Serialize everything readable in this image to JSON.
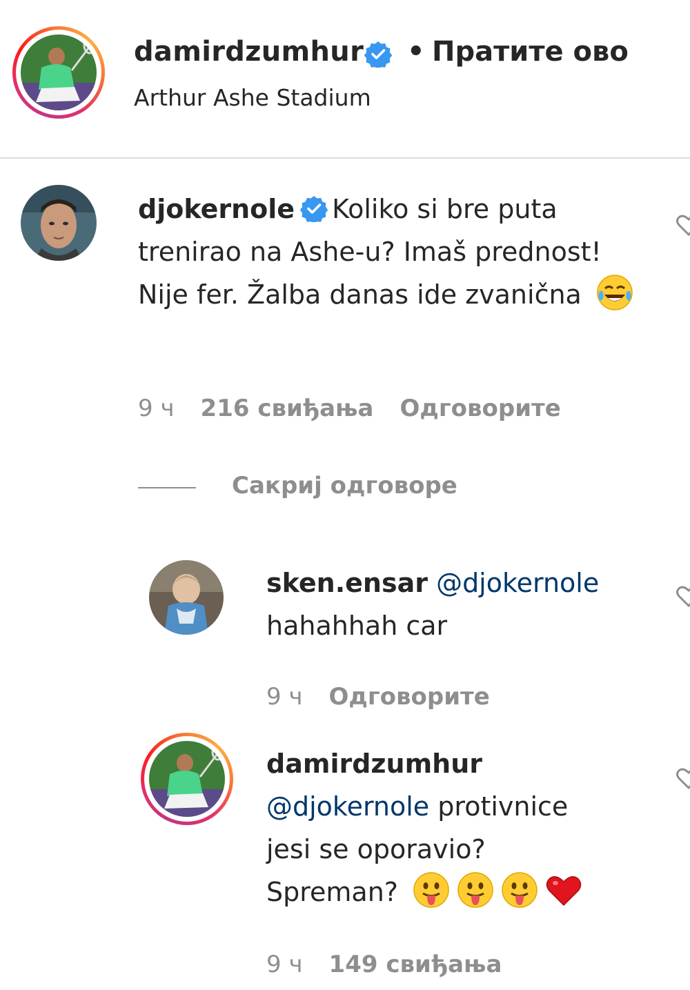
{
  "header": {
    "username": "damirdzumhur",
    "separator": "•",
    "follow_label": "Пратите ово",
    "location": "Arthur Ashe Stadium"
  },
  "comments": [
    {
      "username": "djokernole",
      "text": "Koliko si bre puta trenirao na Ashe-u? Imaš prednost! Nije fer. Žalba danas ide zvanična",
      "emoji": "face-with-tears-of-joy",
      "time": "9 ч",
      "likes": "216 свиђања",
      "reply_label": "Одговорите"
    }
  ],
  "hide_replies_label": "Сакриј одговоре",
  "replies": [
    {
      "username": "sken.ensar",
      "mention": "@djokernole",
      "text": "hahahhah car",
      "time": "9 ч",
      "reply_label": "Одговорите"
    },
    {
      "username": "damirdzumhur",
      "mention": "@djokernole",
      "text_line1": "protivnice",
      "text_line2": "jesi se oporavio?",
      "text_line3": "Spreman?",
      "emojis": [
        "face-with-tongue",
        "face-with-tongue",
        "face-with-tongue",
        "red-heart"
      ],
      "time": "9 ч",
      "likes": "149 свиђања"
    }
  ],
  "colors": {
    "text": "#262626",
    "secondary": "#8e8e8e",
    "mention": "#00376b",
    "verified": "#3897f0",
    "divider": "#dbdbdb"
  }
}
